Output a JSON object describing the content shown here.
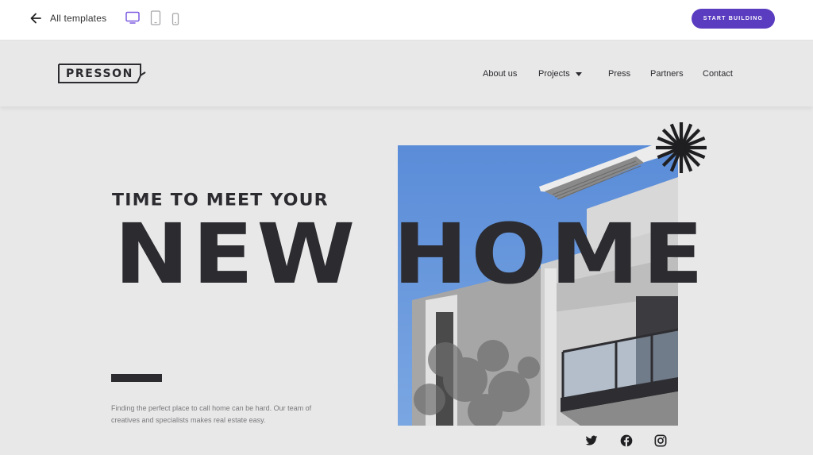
{
  "editor": {
    "back_label": "All templates",
    "devices": [
      {
        "name": "desktop",
        "icon": "desktop-icon",
        "active": true
      },
      {
        "name": "tablet",
        "icon": "tablet-icon",
        "active": false
      },
      {
        "name": "mobile",
        "icon": "mobile-icon",
        "active": false
      }
    ],
    "cta_label": "START BUILDING",
    "accent_color": "#5a3cc0"
  },
  "site": {
    "logo_text": "PRESSON",
    "nav": [
      {
        "label": "About us"
      },
      {
        "label": "Projects",
        "has_dropdown": true
      },
      {
        "label": "Press"
      },
      {
        "label": "Partners"
      },
      {
        "label": "Contact"
      }
    ],
    "hero": {
      "kicker": "TIME TO MEET YOUR",
      "headline": "NEW HOME",
      "blurb_line1": "Finding the perfect place to call home can be hard. Our team of",
      "blurb_line2": "creatives and specialists makes real estate easy."
    },
    "social": [
      {
        "name": "twitter",
        "icon": "twitter-icon"
      },
      {
        "name": "facebook",
        "icon": "facebook-icon"
      },
      {
        "name": "instagram",
        "icon": "instagram-icon"
      }
    ],
    "text_color": "#2b2b30"
  }
}
